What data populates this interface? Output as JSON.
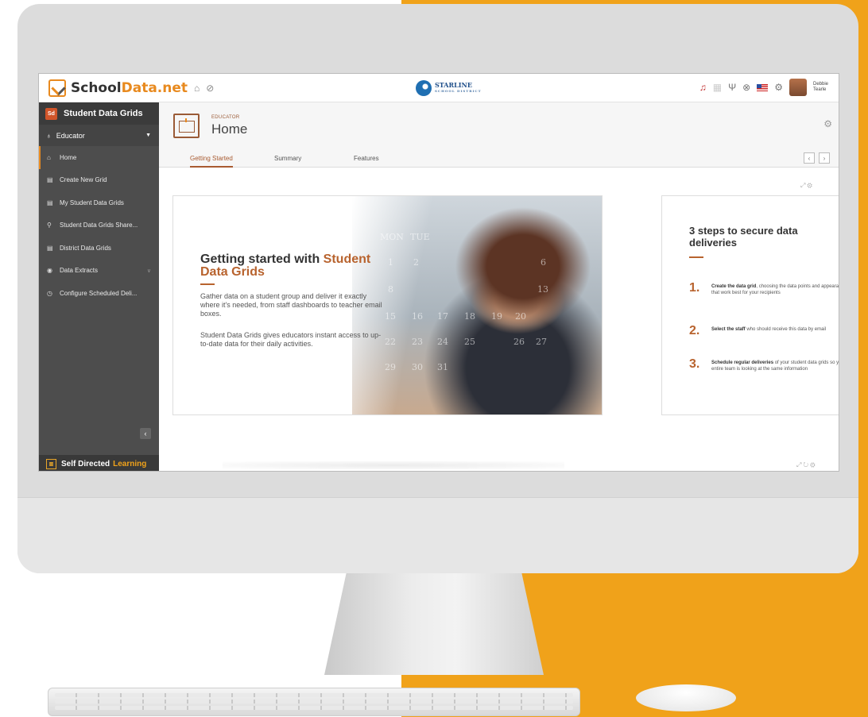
{
  "brand": {
    "logo_main": "School",
    "logo_accent": "Data.net"
  },
  "district": {
    "name": "STARLINE",
    "sub": "SCHOOL DISTRICT"
  },
  "user": {
    "first": "Debbie",
    "last": "Tearle"
  },
  "sidebar": {
    "badge": "Sd",
    "title": "Student Data Grids",
    "role": "Educator",
    "items": [
      {
        "label": "Home",
        "icon": "home-icon"
      },
      {
        "label": "Create New Grid",
        "icon": "grid-icon"
      },
      {
        "label": "My Student Data Grids",
        "icon": "grid-icon"
      },
      {
        "label": "Student Data Grids Share...",
        "icon": "share-icon"
      },
      {
        "label": "District Data Grids",
        "icon": "grid-icon"
      },
      {
        "label": "Data Extracts",
        "icon": "extract-icon"
      },
      {
        "label": "Configure Scheduled Deli...",
        "icon": "clock-icon"
      }
    ],
    "footer_main": "Self Directed",
    "footer_accent": "Learning"
  },
  "page": {
    "role": "EDUCATOR",
    "title": "Home"
  },
  "tabs": [
    {
      "label": "Getting Started"
    },
    {
      "label": "Summary"
    },
    {
      "label": "Features"
    }
  ],
  "hero": {
    "title_lead": "Getting started with ",
    "title_accent": "Student Data Grids",
    "para1": "Gather data on a student group and deliver it exactly where it's needed, from staff dashboards to teacher email boxes.",
    "para2": "Student Data Grids gives educators instant access to up-to-date data for their daily activities.",
    "calendar": [
      "MON",
      "TUE",
      "1",
      "2",
      "6",
      "8",
      "13",
      "15",
      "16",
      "17",
      "18",
      "19",
      "20",
      "22",
      "23",
      "24",
      "25",
      "26",
      "27",
      "29",
      "30",
      "31"
    ]
  },
  "steps": {
    "title": "3 steps to secure data deliveries",
    "items": [
      {
        "num": "1.",
        "bold": "Create the data grid",
        "rest": ", choosing the data points and appearance that work best for your recipients"
      },
      {
        "num": "2.",
        "bold": "Select the staff",
        "rest": " who should receive this data by email"
      },
      {
        "num": "3.",
        "bold": "Schedule regular deliveries",
        "rest": " of your student data grids so your entire team is looking at the same information"
      }
    ]
  },
  "colors": {
    "accent": "#b8632e",
    "brand_orange": "#e88a1f",
    "background_orange": "#f0a21a",
    "sidebar": "#4d4d4d"
  }
}
